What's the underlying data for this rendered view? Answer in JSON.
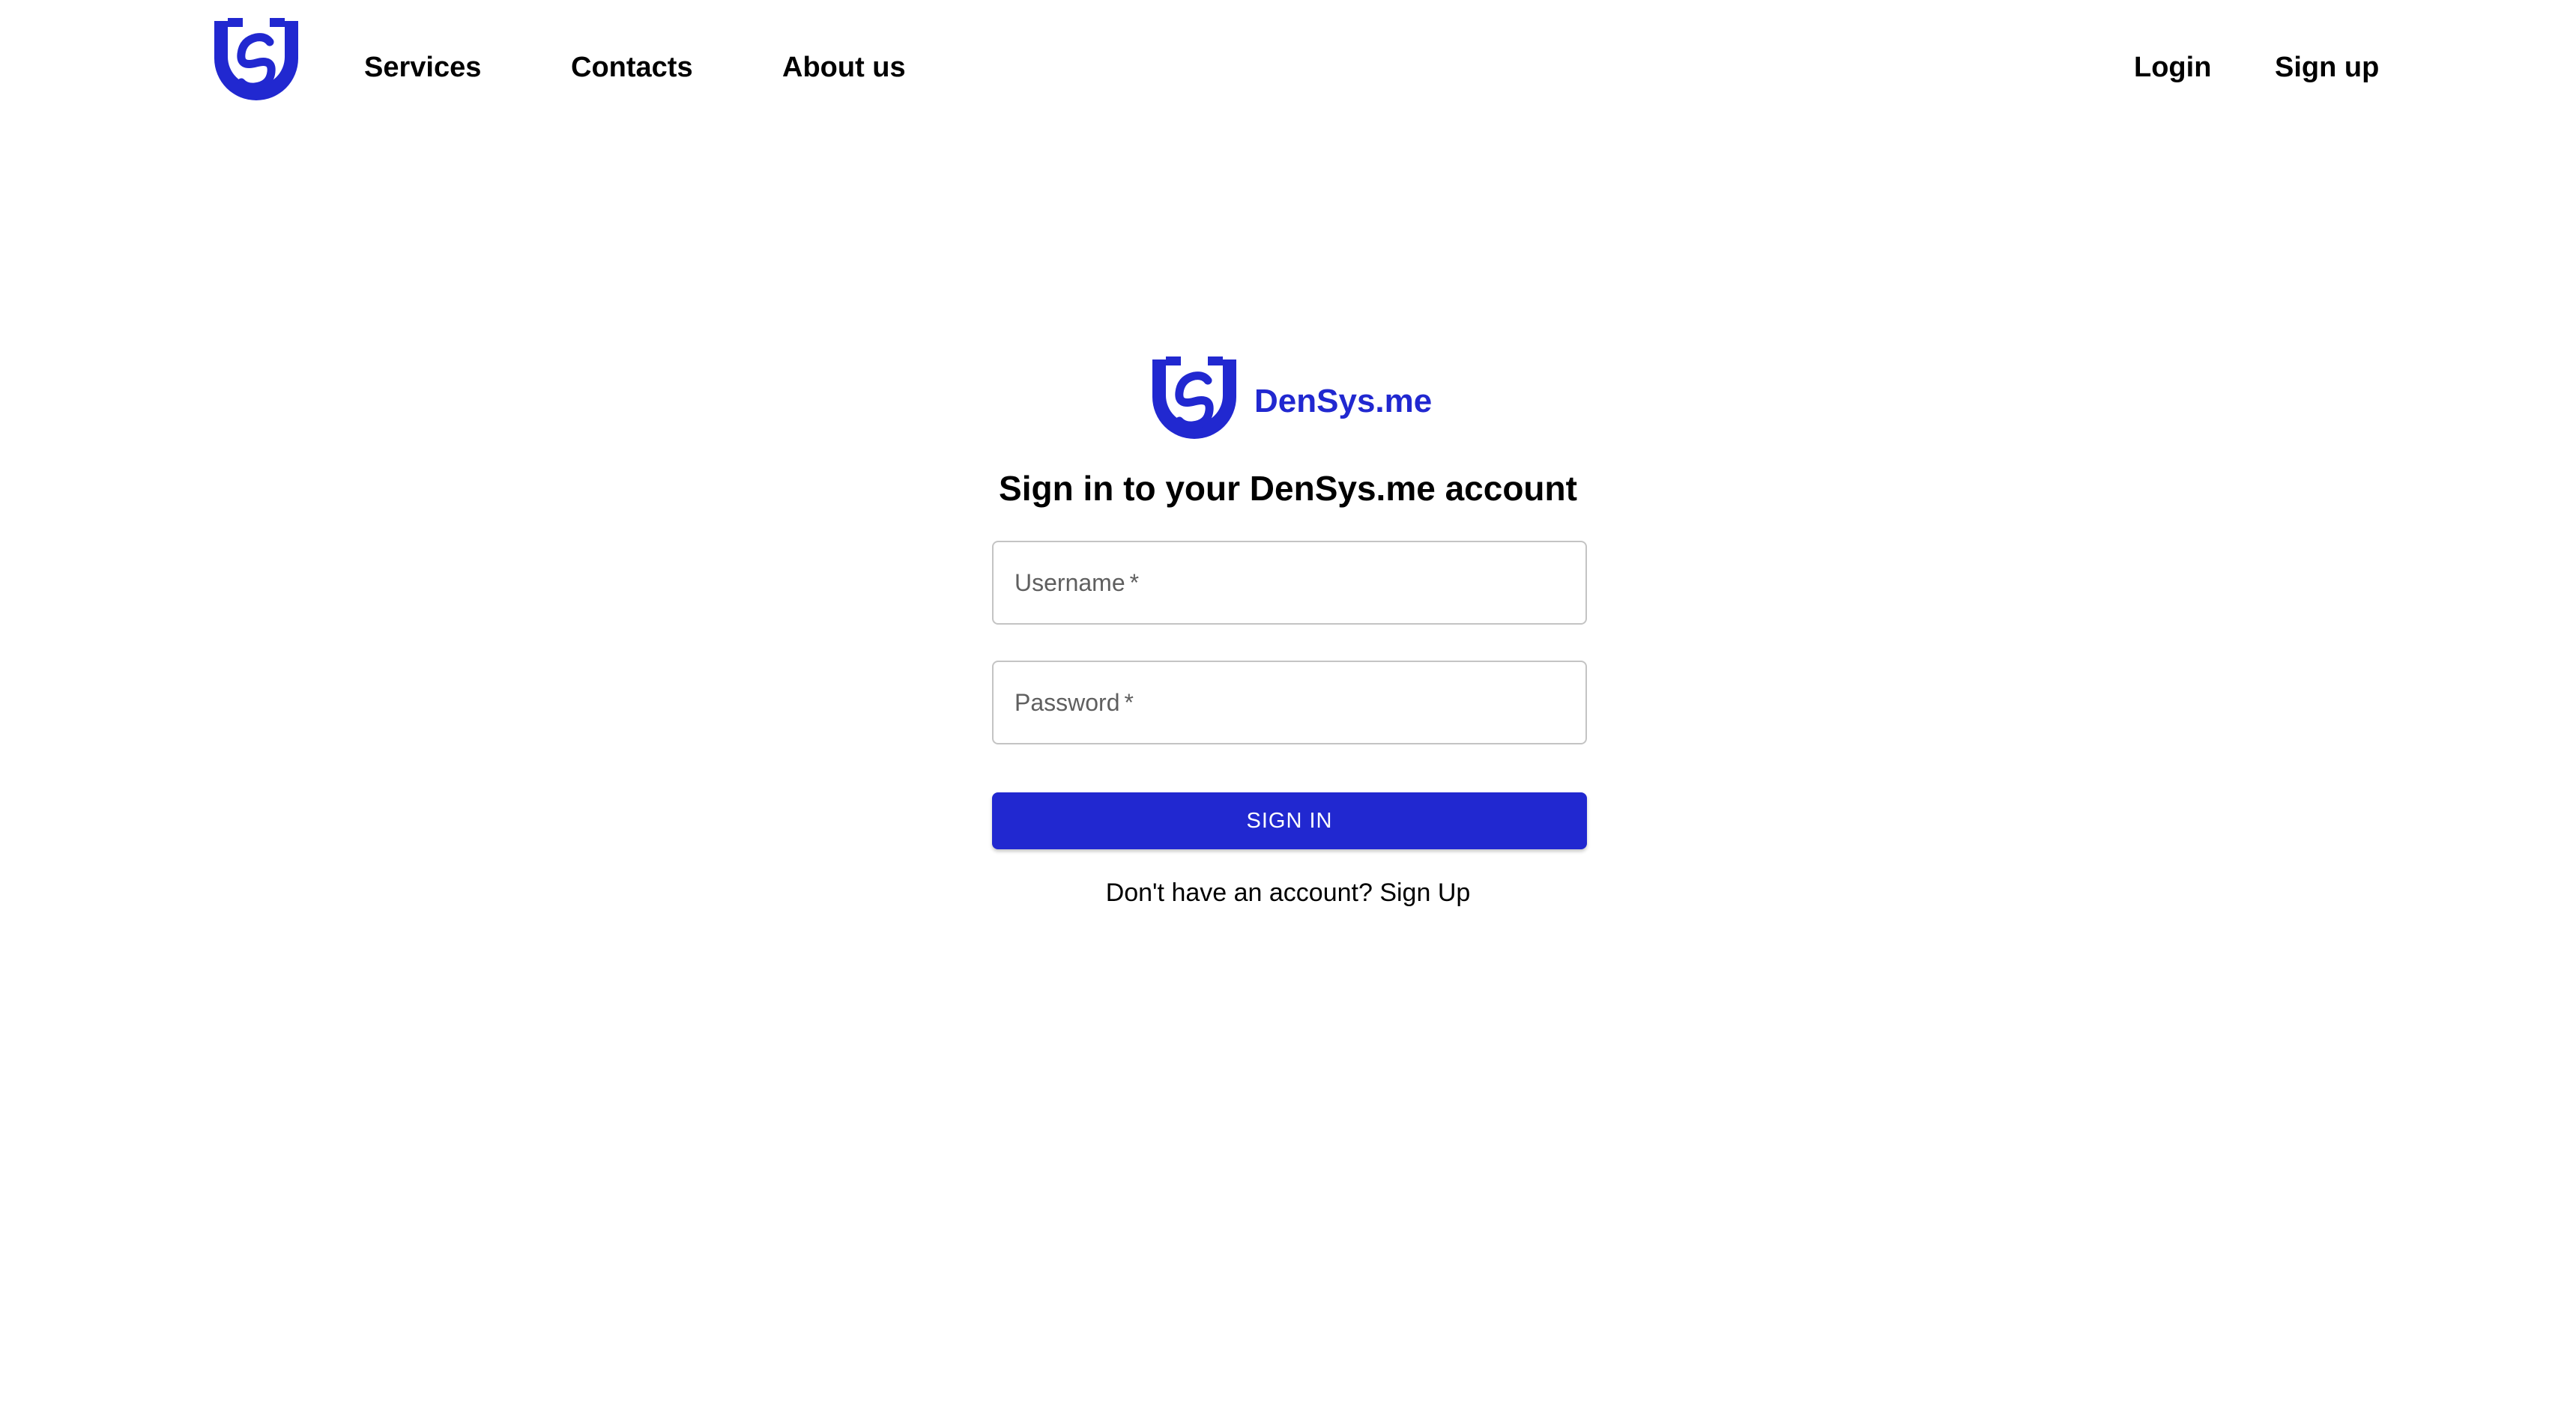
{
  "colors": {
    "brand": "#2128d0",
    "text": "#000000",
    "field_border": "#c4c4c4",
    "label": "#5f5f5f",
    "background": "#ffffff"
  },
  "nav": {
    "logo_icon": "densys-shield-logo",
    "links": [
      "Services",
      "Contacts",
      "About us"
    ],
    "login_label": "Login",
    "signup_label": "Sign up"
  },
  "brand": {
    "logo_icon": "densys-shield-logo",
    "name": "DenSys.me"
  },
  "form": {
    "title": "Sign in to your DenSys.me account",
    "username_label": "Username",
    "password_label": "Password",
    "required_marker": "*",
    "submit_label": "SIGN IN",
    "no_account_text": "Don't have an account?",
    "signup_link_label": "Sign Up"
  }
}
